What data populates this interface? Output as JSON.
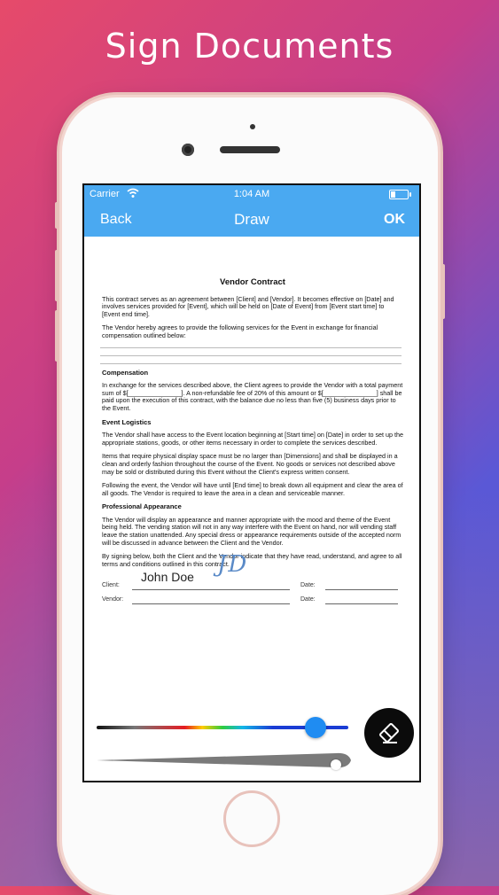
{
  "headline": "Sign Documents",
  "status": {
    "carrier": "Carrier",
    "time": "1:04 AM"
  },
  "nav": {
    "back_label": "Back",
    "title": "Draw",
    "ok_label": "OK"
  },
  "document": {
    "title": "Vendor Contract",
    "intro_1": "This contract serves as an agreement between [Client] and [Vendor]. It becomes effective on [Date] and involves services provided for [Event], which will be held on [Date of Event] from [Event start time] to [Event end time].",
    "intro_2": "The Vendor hereby agrees to provide the following services for the Event in exchange for financial compensation outlined below:",
    "compensation_heading": "Compensation",
    "compensation_text": "In exchange for the services described above, the Client agrees to provide the Vendor with a total payment sum of $[_______________]. A non-refundable fee of 20% of this amount or $[_______________] shall be paid upon the execution of this contract, with the balance due no less than five (5) business days prior to the Event.",
    "logistics_heading": "Event Logistics",
    "logistics_1": "The Vendor shall have access to the Event location beginning at [Start time] on [Date] in order to set up the appropriate stations, goods, or other items necessary in order to complete the services described.",
    "logistics_2": "Items that require physical display space must be no larger than [Dimensions] and shall be displayed in a clean and orderly fashion throughout the course of the Event. No goods or services not described above may be sold or distributed during this Event without the Client's express written consent.",
    "logistics_3": "Following the event, the Vendor will have until [End time] to break down all equipment and clear the area of all goods. The Vendor is required to leave the area in a clean and serviceable manner.",
    "appearance_heading": "Professional Appearance",
    "appearance_text": "The Vendor will display an appearance and manner appropriate with the mood and theme of the Event being held. The vending station will not in any way interfere with the Event on hand, nor will vending staff leave the station unattended. Any special dress or appearance requirements outside of the accepted norm will be discussed in advance between the Client and the Vendor.",
    "closing_text": "By signing below, both the Client and the Vendor indicate that they have read, understand, and agree to all terms and conditions outlined in this contract.",
    "client_label": "Client:",
    "vendor_label": "Vendor:",
    "date_label_1": "Date:",
    "date_label_2": "Date:",
    "client_name": "John Doe",
    "signature_mark": "JD"
  },
  "tools": {
    "color_position": 0.87,
    "width_position": 0.93
  },
  "colors": {
    "nav_bar": "#4aa9f1",
    "slider_thumb": "#1f8cf2",
    "eraser_button": "#0b0b0b"
  }
}
